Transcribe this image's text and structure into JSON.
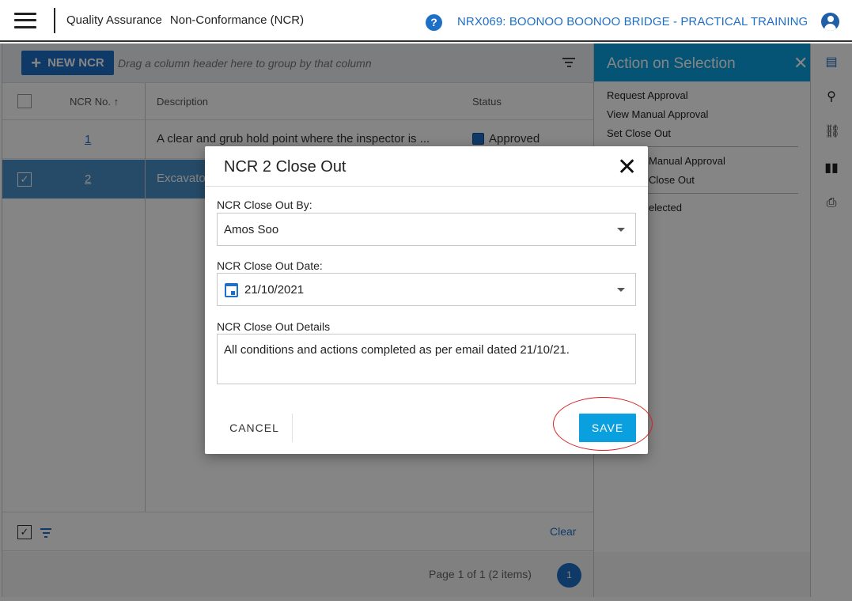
{
  "header": {
    "module": "Quality Assurance",
    "page": "Non-Conformance (NCR)",
    "project": "NRX069: BOONOO BOONOO BRIDGE - PRACTICAL TRAINING"
  },
  "toolbar": {
    "new_button": "NEW NCR",
    "group_hint": "Drag a column header here to group by that column"
  },
  "grid": {
    "columns": [
      "NCR No. ↑",
      "Description",
      "Status"
    ],
    "rows": [
      {
        "no": "1",
        "description": "A clear and grub hold point where the inspector is ...",
        "status": "Approved",
        "selected": false
      },
      {
        "no": "2",
        "description": "Excavato",
        "status": "",
        "selected": true
      }
    ],
    "clear_label": "Clear",
    "pager_info": "Page 1 of 1 (2 items)",
    "current_page": "1"
  },
  "side_panel": {
    "title": "Action on Selection",
    "group1": [
      "Request Approval",
      "View Manual Approval",
      "Set Close Out"
    ],
    "group2": [
      "Manual Approval",
      "Close Out"
    ],
    "group3": [
      "elected"
    ]
  },
  "modal": {
    "title": "NCR 2 Close Out",
    "close_by_label": "NCR Close Out By:",
    "close_by_value": "Amos Soo",
    "close_date_label": "NCR Close Out Date:",
    "close_date_value": "21/10/2021",
    "details_label": "NCR Close Out Details",
    "details_value": "All conditions and actions completed as per email dated 21/10/21.",
    "cancel_label": "CANCEL",
    "save_label": "SAVE"
  },
  "colors": {
    "primary": "#1e6fc8",
    "accent": "#0aa0e0",
    "selected_row": "#4a90c9",
    "annotation": "#d42020"
  }
}
